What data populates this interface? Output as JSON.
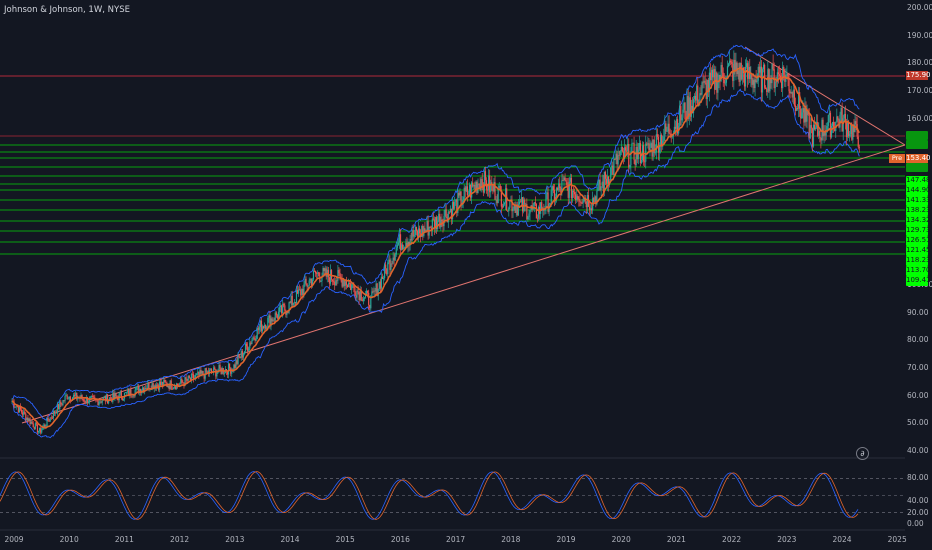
{
  "header": {
    "title": "Johnson & Johnson, 1W, NYSE"
  },
  "price_axis": [
    "200.00",
    "190.00",
    "180.00",
    "170.00",
    "160.00",
    "150.00",
    "140.00",
    "130.00",
    "120.00",
    "110.00",
    "100.00",
    "90.00",
    "80.00",
    "70.00",
    "60.00",
    "50.00",
    "40.00"
  ],
  "levels": [
    "147.48",
    "144.90",
    "141.33",
    "138.23",
    "134.32",
    "129.73",
    "126.51",
    "121.45",
    "118.23",
    "113.70",
    "109.41"
  ],
  "resistance_label": "175.90",
  "current_price": "153.40",
  "pre_tag": "Pre",
  "osc_axis": [
    "80.00",
    "40.00",
    "20.00",
    "0.00"
  ],
  "years": [
    "2009",
    "2010",
    "2011",
    "2012",
    "2013",
    "2014",
    "2015",
    "2016",
    "2017",
    "2018",
    "2019",
    "2020",
    "2021",
    "2022",
    "2023",
    "2024",
    "2025"
  ],
  "logo_glyph": "∂",
  "colors": {
    "background": "#131722",
    "candle": "#26a69a",
    "ma": "#e0642c",
    "bands": "#2962ff",
    "levels": "#00ff00",
    "resistance": "#b2283a",
    "trendline": "#e1746f"
  },
  "chart_data": {
    "type": "candlestick",
    "title": "Johnson & Johnson, 1W, NYSE",
    "ylim": [
      40,
      200
    ],
    "x": [
      2009.0,
      2009.5,
      2010.0,
      2010.5,
      2011.0,
      2011.5,
      2012.0,
      2012.5,
      2013.0,
      2013.5,
      2014.0,
      2014.5,
      2015.0,
      2015.5,
      2016.0,
      2016.5,
      2017.0,
      2017.5,
      2018.0,
      2018.5,
      2019.0,
      2019.5,
      2020.0,
      2020.5,
      2021.0,
      2021.5,
      2022.0,
      2022.5,
      2023.0,
      2023.5,
      2024.0,
      2024.35
    ],
    "close": [
      58,
      47,
      60,
      58,
      60,
      64,
      64,
      68,
      70,
      85,
      92,
      104,
      102,
      94,
      115,
      120,
      128,
      138,
      130,
      126,
      136,
      130,
      146,
      148,
      158,
      170,
      178,
      174,
      176,
      154,
      160,
      153.4
    ],
    "indicators": [
      "moving average",
      "bollinger bands",
      "stochastic RSI"
    ],
    "grid": false
  }
}
